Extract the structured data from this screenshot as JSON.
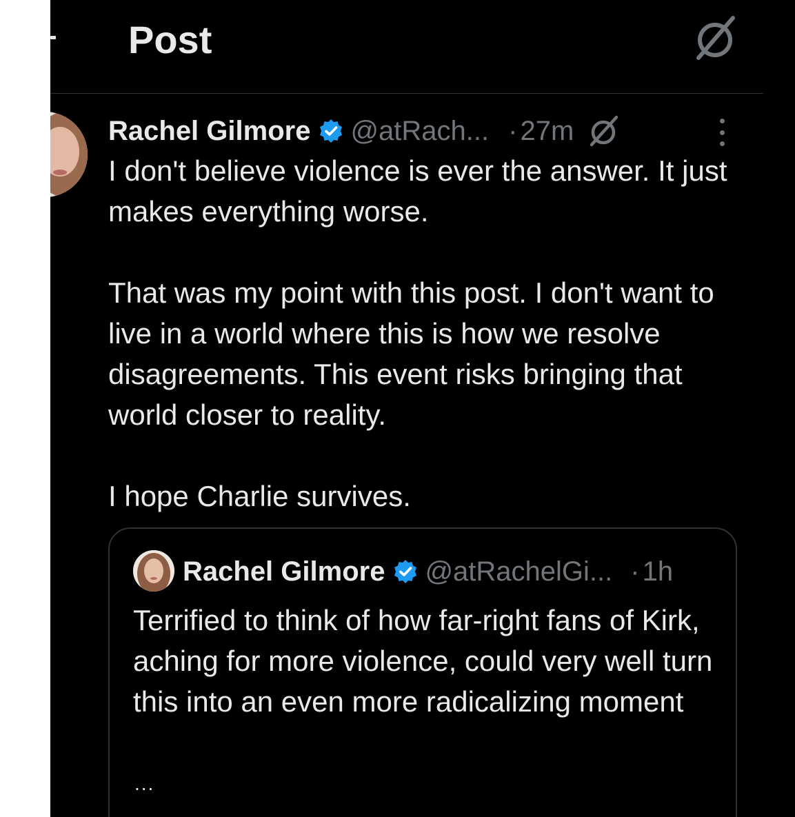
{
  "header": {
    "title": "Post",
    "grok_icon": "grok-icon",
    "back_icon": "back-arrow-icon"
  },
  "post": {
    "author_name": "Rachel Gilmore",
    "verified": true,
    "handle": "@atRach...",
    "separator": "·",
    "time": "27m",
    "paragraphs": [
      "I don't believe violence is ever the answer. It just makes everything worse.",
      "That was my point with this post. I don't want to live in a world where this is how we resolve disagreements. This event risks bringing that world closer to reality.",
      "I hope Charlie survives."
    ]
  },
  "quoted_post": {
    "author_name": "Rachel Gilmore",
    "verified": true,
    "handle": "@atRachelGi...",
    "separator": "·",
    "time": "1h",
    "text": "Terrified to think of how far-right fans of Kirk, aching for more violence, could very well turn this into an even more radicalizing moment",
    "truncation": "..."
  },
  "colors": {
    "background": "#000000",
    "text_primary": "#e7e9ea",
    "text_secondary": "#71767b",
    "divider": "#2f3336",
    "verified_blue": "#1d9bf0"
  }
}
